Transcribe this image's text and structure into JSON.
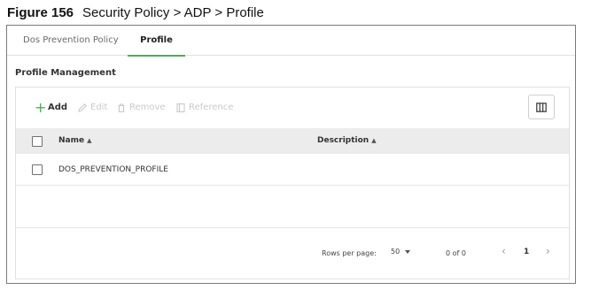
{
  "figure": {
    "number": "Figure 156",
    "title": "Security Policy > ADP > Profile"
  },
  "tabs": [
    {
      "label": "Dos Prevention Policy",
      "active": false
    },
    {
      "label": "Profile",
      "active": true
    }
  ],
  "section": {
    "title": "Profile Management"
  },
  "toolbar": {
    "add_label": "Add",
    "edit_label": "Edit",
    "remove_label": "Remove",
    "reference_label": "Reference"
  },
  "table": {
    "columns": [
      "Name",
      "Description"
    ],
    "rows": [
      {
        "name": "DOS_PREVENTION_PROFILE",
        "description": ""
      }
    ]
  },
  "pagination": {
    "rows_per_page_label": "Rows per page:",
    "rows_per_page": "50",
    "count": "0 of 0",
    "current_page": "1"
  },
  "colors": {
    "accent": "#4caf50",
    "header_bg": "#ececec",
    "disabled": "#c9c9c9"
  }
}
